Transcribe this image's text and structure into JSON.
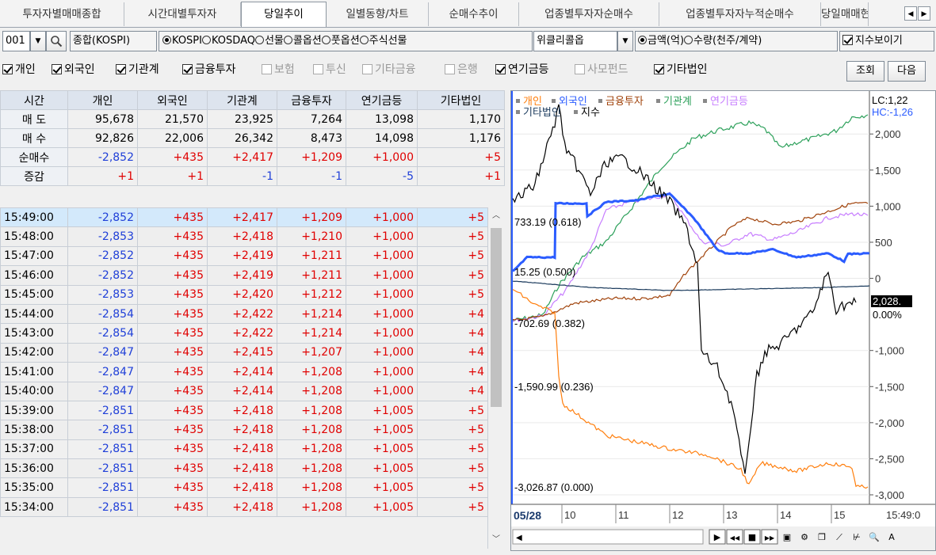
{
  "tabs": [
    {
      "label": "투자자별매매종합",
      "active": false
    },
    {
      "label": "시간대별투자자",
      "active": false
    },
    {
      "label": "당일추이",
      "active": true
    },
    {
      "label": "일별동향/차트",
      "active": false
    },
    {
      "label": "순매수추이",
      "active": false
    },
    {
      "label": "업종별투자자순매수",
      "active": false
    },
    {
      "label": "업종별투자자누적순매수",
      "active": false
    },
    {
      "label": "당일매매현",
      "active": false
    }
  ],
  "toolbar": {
    "code_value": "001",
    "market_name": "종합(KOSPI)",
    "market_radios": [
      {
        "label": "KOSPI",
        "selected": true
      },
      {
        "label": "KOSDAQ",
        "selected": false
      },
      {
        "label": "선물",
        "selected": false
      },
      {
        "label": "콜옵션",
        "selected": false
      },
      {
        "label": "풋옵션",
        "selected": false
      },
      {
        "label": "주식선물",
        "selected": false
      }
    ],
    "weekly_call_value": "위클리콜옵",
    "unit_radios": [
      {
        "label": "금액(억)",
        "selected": true
      },
      {
        "label": "수량(천주/계약)",
        "selected": false
      }
    ],
    "show_index_label": "지수보이기",
    "show_index_checked": true
  },
  "filters": [
    {
      "label": "개인",
      "checked": true,
      "enabled": true
    },
    {
      "label": "외국인",
      "checked": true,
      "enabled": true
    },
    {
      "label": "기관계",
      "checked": true,
      "enabled": true
    },
    {
      "label": "금융투자",
      "checked": true,
      "enabled": true
    },
    {
      "label": "보험",
      "checked": false,
      "enabled": false
    },
    {
      "label": "투신",
      "checked": false,
      "enabled": false
    },
    {
      "label": "기타금융",
      "checked": false,
      "enabled": false
    },
    {
      "label": "은행",
      "checked": false,
      "enabled": false
    },
    {
      "label": "연기금등",
      "checked": true,
      "enabled": true
    },
    {
      "label": "사모펀드",
      "checked": false,
      "enabled": false
    },
    {
      "label": "기타법인",
      "checked": true,
      "enabled": true
    }
  ],
  "buttons": {
    "query": "조회",
    "next": "다음"
  },
  "summary": {
    "headers": [
      "시간",
      "개인",
      "외국인",
      "기관계",
      "금융투자",
      "연기금등",
      "기타법인"
    ],
    "rows": [
      {
        "label": "매 도",
        "values": [
          "95,678",
          "21,570",
          "23,925",
          "7,264",
          "13,098",
          "1,170"
        ]
      },
      {
        "label": "매 수",
        "values": [
          "92,826",
          "22,006",
          "26,342",
          "8,473",
          "14,098",
          "1,176"
        ]
      },
      {
        "label": "순매수",
        "values": [
          "-2,852",
          "+435",
          "+2,417",
          "+1,209",
          "+1,000",
          "+5"
        ]
      },
      {
        "label": "증감",
        "values": [
          "+1",
          "+1",
          "-1",
          "-1",
          "-5",
          "+1"
        ]
      }
    ]
  },
  "time_rows": [
    [
      "15:49:00",
      "-2,852",
      "+435",
      "+2,417",
      "+1,209",
      "+1,000",
      "+5"
    ],
    [
      "15:48:00",
      "-2,853",
      "+435",
      "+2,418",
      "+1,210",
      "+1,000",
      "+5"
    ],
    [
      "15:47:00",
      "-2,852",
      "+435",
      "+2,419",
      "+1,211",
      "+1,000",
      "+5"
    ],
    [
      "15:46:00",
      "-2,852",
      "+435",
      "+2,419",
      "+1,211",
      "+1,000",
      "+5"
    ],
    [
      "15:45:00",
      "-2,853",
      "+435",
      "+2,420",
      "+1,212",
      "+1,000",
      "+5"
    ],
    [
      "15:44:00",
      "-2,854",
      "+435",
      "+2,422",
      "+1,214",
      "+1,000",
      "+4"
    ],
    [
      "15:43:00",
      "-2,854",
      "+435",
      "+2,422",
      "+1,214",
      "+1,000",
      "+4"
    ],
    [
      "15:42:00",
      "-2,847",
      "+435",
      "+2,415",
      "+1,207",
      "+1,000",
      "+4"
    ],
    [
      "15:41:00",
      "-2,847",
      "+435",
      "+2,414",
      "+1,208",
      "+1,000",
      "+4"
    ],
    [
      "15:40:00",
      "-2,847",
      "+435",
      "+2,414",
      "+1,208",
      "+1,000",
      "+4"
    ],
    [
      "15:39:00",
      "-2,851",
      "+435",
      "+2,418",
      "+1,208",
      "+1,005",
      "+5"
    ],
    [
      "15:38:00",
      "-2,851",
      "+435",
      "+2,418",
      "+1,208",
      "+1,005",
      "+5"
    ],
    [
      "15:37:00",
      "-2,851",
      "+435",
      "+2,418",
      "+1,208",
      "+1,005",
      "+5"
    ],
    [
      "15:36:00",
      "-2,851",
      "+435",
      "+2,418",
      "+1,208",
      "+1,005",
      "+5"
    ],
    [
      "15:35:00",
      "-2,851",
      "+435",
      "+2,418",
      "+1,208",
      "+1,005",
      "+5"
    ],
    [
      "15:34:00",
      "-2,851",
      "+435",
      "+2,418",
      "+1,208",
      "+1,005",
      "+5"
    ]
  ],
  "chart": {
    "legend": [
      {
        "name": "개인",
        "color": "#ff7f0e"
      },
      {
        "name": "외국인",
        "color": "#2b5cff"
      },
      {
        "name": "금융투자",
        "color": "#a0420a"
      },
      {
        "name": "기관계",
        "color": "#2ca05a"
      },
      {
        "name": "연기금등",
        "color": "#c77dff"
      },
      {
        "name": "기타법인",
        "color": "#1a3a5c"
      },
      {
        "name": "지수",
        "color": "#000000"
      }
    ],
    "lc_label": "LC:1,22",
    "hc_label": "HC:-1,26",
    "y_ticks": [
      "2,000",
      "1,500",
      "1,000",
      "500",
      "0",
      "-1,000",
      "-1,500",
      "-2,000",
      "-2,500",
      "-3,000"
    ],
    "y_range": [
      -3000,
      2200
    ],
    "current_value": "2,028.",
    "current_pct": "0.00%",
    "annotations": [
      "733.19 (0.618)",
      "15.25 (0.500)",
      "-702.69 (0.382)",
      "-1,590.99 (0.236)",
      "-3,026.87 (0.000)"
    ],
    "x_date": "05/28",
    "x_ticks": [
      "10",
      "11",
      "12",
      "13",
      "14",
      "15"
    ],
    "x_time": "15:49:0",
    "nav_icons": [
      "play-icon",
      "rewind-icon",
      "stop-icon",
      "forward-icon",
      "chart-type-icon",
      "settings-icon",
      "window-icon",
      "line-icon",
      "cursor-icon",
      "zoom-icon",
      "text-icon"
    ]
  }
}
